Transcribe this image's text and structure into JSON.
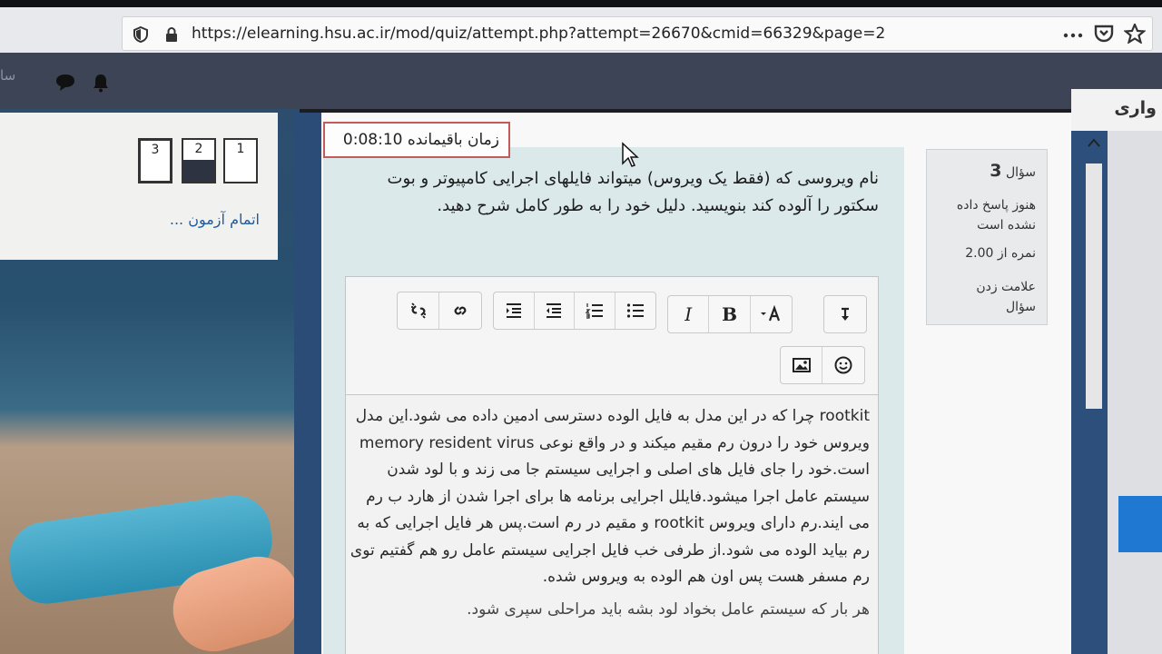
{
  "browser": {
    "url": "https://elearning.hsu.ac.ir/mod/quiz/attempt.php?attempt=26670&cmid=66329&page=2"
  },
  "navbar": {
    "site_short": "سا",
    "site_title": "واری"
  },
  "quiz_nav": {
    "buttons": [
      {
        "label": "3"
      },
      {
        "label": "2"
      },
      {
        "label": "1"
      }
    ],
    "finish_label": "اتمام آزمون ..."
  },
  "timer": {
    "text": "زمان باقیمانده 0:08:10"
  },
  "question": {
    "text": "نام ویروسی که (فقط یک ویروس) میتواند فایلهای اجرایی کامپیوتر و بوت سکتور را آلوده کند بنویسید. دلیل خود را به طور کامل شرح دهید.",
    "answer_p1": "rootkit چرا که در این مدل به فایل الوده دسترسی ادمین داده می شود.این مدل ویروس خود را درون رم مقیم میکند و در واقع نوعی memory resident virus است.خود را جای فایل های اصلی و اجرایی سیستم جا می زند و با لود شدن سیستم عامل اجرا میشود.فایلل اجرایی برنامه ها برای اجرا شدن از هارد ب رم می ایند.رم دارای ویروس rootkit و مقیم در رم است.پس هر فایل اجرایی که به رم بیاید الوده می شود.از طرفی خب فایل اجرایی سیستم عامل رو هم گفتیم توی رم مسفر هست پس اون هم الوده به ویروس شده.",
    "answer_p2": "هر بار که سیستم عامل بخواد لود بشه باید مراحلی سپری شود."
  },
  "info": {
    "question_label": "سؤال",
    "question_number": "3",
    "status": "هنوز پاسخ داده نشده است",
    "mark": "نمره از 2.00",
    "flag": "علامت زدن سؤال"
  },
  "colors": {
    "navbar": "#3d4455",
    "timer_border": "#c45b5b",
    "question_bg": "#dbe9ea",
    "link": "#1f5c9e"
  }
}
